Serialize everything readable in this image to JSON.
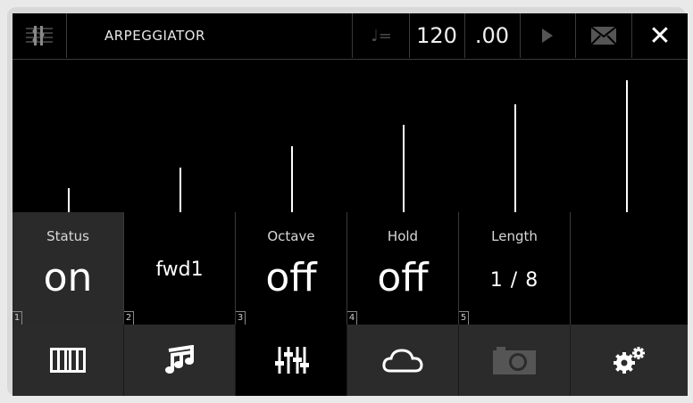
{
  "app": {
    "title": "ARPEGGIATOR"
  },
  "transport": {
    "tempo_symbol": "♩=",
    "bpm": "120",
    "bpm_fraction": ".00"
  },
  "icons": {
    "menu": "staff-menu-icon",
    "play": "play-icon",
    "mail": "mail-icon",
    "close": "close-icon"
  },
  "close_label": "✕",
  "graph": {
    "note": "step graph",
    "steps": [
      0.18,
      0.34,
      0.5,
      0.66,
      0.82,
      1.0
    ]
  },
  "params": [
    {
      "index": "1",
      "label": "Status",
      "value": "on"
    },
    {
      "index": "2",
      "label": "",
      "value": "fwd1"
    },
    {
      "index": "3",
      "label": "Octave",
      "value": "off"
    },
    {
      "index": "4",
      "label": "Hold",
      "value": "off"
    },
    {
      "index": "5",
      "label": "Length",
      "value": "1 / 8"
    },
    {
      "index": "",
      "label": "",
      "value": ""
    }
  ],
  "nav": [
    {
      "name": "piano-icon"
    },
    {
      "name": "music-note-icon"
    },
    {
      "name": "mixer-sliders-icon"
    },
    {
      "name": "cloud-icon"
    },
    {
      "name": "camera-icon"
    },
    {
      "name": "settings-gears-icon"
    }
  ],
  "colors": {
    "background": "#000000",
    "accent": "#ffffff",
    "inactive": "#444444"
  }
}
